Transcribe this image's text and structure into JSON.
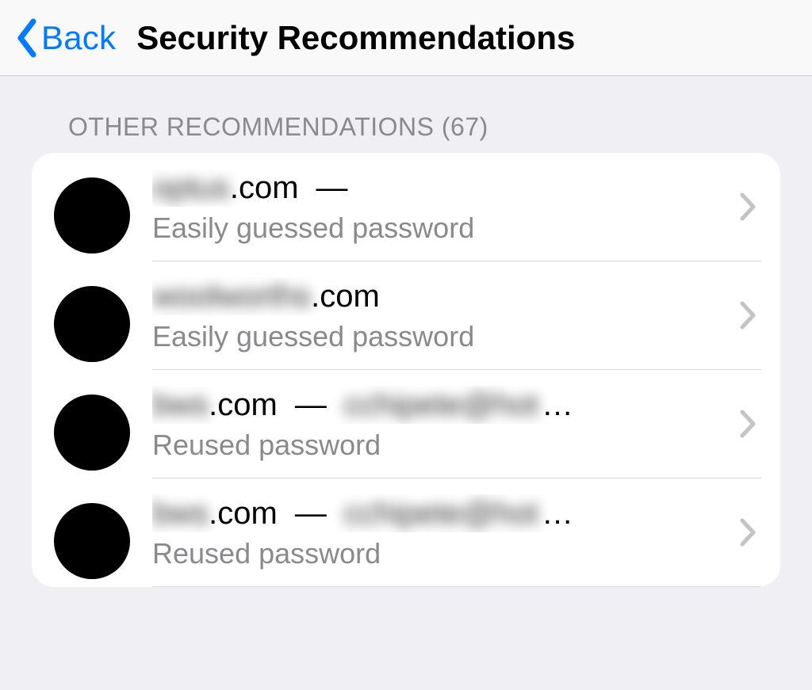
{
  "navbar": {
    "back_label": "Back",
    "title": "Security Recommendations"
  },
  "section": {
    "header_prefix": "OTHER RECOMMENDATIONS",
    "count": 67
  },
  "items": [
    {
      "domain_blur": "optus",
      "domain_suffix": ".com",
      "separator": "—",
      "extra_blur": "",
      "extra_ellipsis": "",
      "subtitle": "Easily guessed password"
    },
    {
      "domain_blur": "woolworths",
      "domain_suffix": ".com",
      "separator": "",
      "extra_blur": "",
      "extra_ellipsis": "",
      "subtitle": "Easily guessed password"
    },
    {
      "domain_blur": "bws",
      "domain_suffix": ".com",
      "separator": "—",
      "extra_blur": "cchipete@hot",
      "extra_ellipsis": "…",
      "subtitle": "Reused password"
    },
    {
      "domain_blur": "bws",
      "domain_suffix": ".com",
      "separator": "—",
      "extra_blur": "cchipete@hot",
      "extra_ellipsis": "…",
      "subtitle": "Reused password"
    }
  ],
  "colors": {
    "tint": "#007aff",
    "secondary": "#8a8a8e",
    "page_bg": "#efeff4",
    "card_bg": "#ffffff",
    "separator": "#d7d7db"
  }
}
